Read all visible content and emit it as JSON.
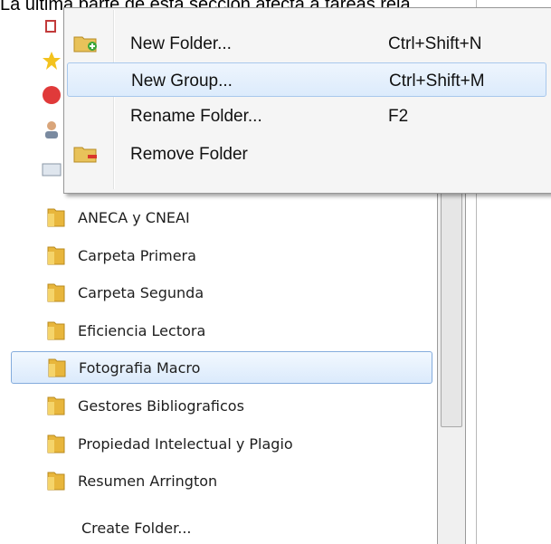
{
  "caption": "La última parte de esta sección afecta a tareas rela",
  "context_menu": {
    "items": [
      {
        "label": "New Folder...",
        "shortcut": "Ctrl+Shift+N",
        "icon": "folder-add-icon"
      },
      {
        "label": "New Group...",
        "shortcut": "Ctrl+Shift+M",
        "icon": ""
      },
      {
        "label": "Rename Folder...",
        "shortcut": "F2",
        "icon": ""
      },
      {
        "label": "Remove Folder",
        "shortcut": "",
        "icon": "folder-remove-icon"
      }
    ]
  },
  "folders": [
    {
      "label": "ANECA y CNEAI"
    },
    {
      "label": "Carpeta Primera"
    },
    {
      "label": "Carpeta Segunda"
    },
    {
      "label": "Eficiencia Lectora"
    },
    {
      "label": "Fotografia Macro"
    },
    {
      "label": "Gestores Bibliograficos"
    },
    {
      "label": "Propiedad Intelectual y Plagio"
    },
    {
      "label": "Resumen Arrington"
    }
  ],
  "create_folder_label": "Create Folder...",
  "colors": {
    "folder": "#e8b63c",
    "selection_border": "#84acdd",
    "menu_bg": "#f5f5f5"
  }
}
